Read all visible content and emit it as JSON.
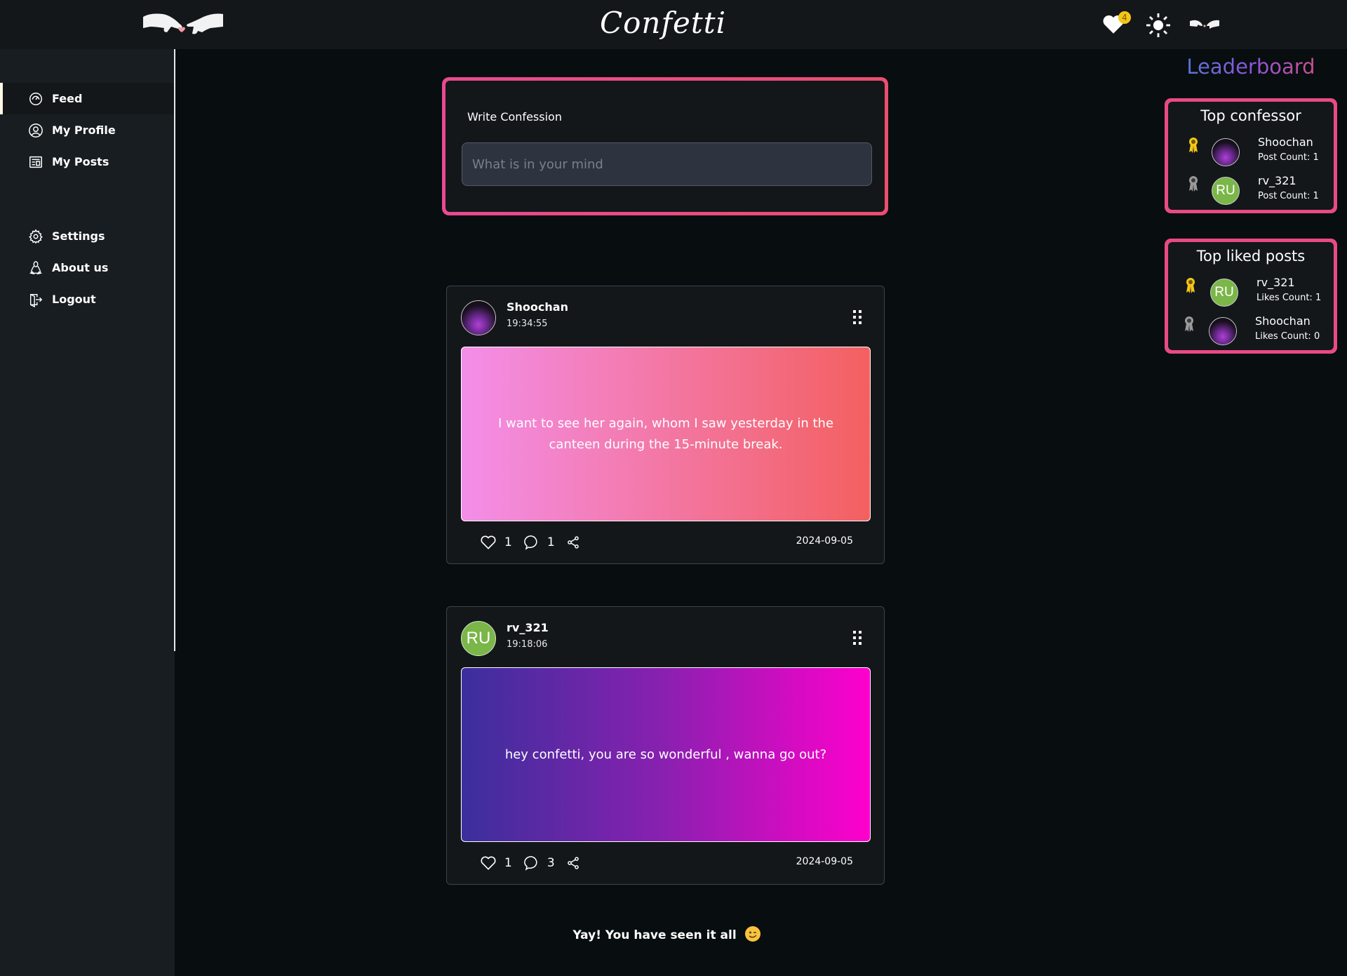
{
  "header": {
    "brand": "Confetti",
    "notification_count": "4",
    "icons": [
      "hands-logo-icon",
      "heart-icon",
      "sun-icon",
      "hands-icon"
    ]
  },
  "sidebar": {
    "items": [
      {
        "label": "Feed",
        "icon": "speedometer-icon",
        "active": true
      },
      {
        "label": "My Profile",
        "icon": "user-circle-icon",
        "active": false
      },
      {
        "label": "My Posts",
        "icon": "newspaper-icon",
        "active": false
      },
      {
        "label": "Settings",
        "icon": "gear-icon",
        "active": false
      },
      {
        "label": "About us",
        "icon": "linux-icon",
        "active": false
      },
      {
        "label": "Logout",
        "icon": "logout-icon",
        "active": false
      }
    ]
  },
  "composer": {
    "label": "Write Confession",
    "placeholder": "What is in your mind",
    "value": ""
  },
  "posts": [
    {
      "username": "Shoochan",
      "time": "19:34:55",
      "avatar": "image",
      "text": "I want to see her again, whom I saw yesterday in the canteen during the 15-minute break.",
      "likes": "1",
      "comments": "1",
      "date": "2024-09-05",
      "gradient": [
        "#f38ee8",
        "#f36060"
      ]
    },
    {
      "username": "rv_321",
      "time": "19:18:06",
      "avatar": "RU",
      "text": "hey confetti, you are so wonderful , wanna go out?",
      "likes": "1",
      "comments": "3",
      "date": "2024-09-05",
      "gradient": [
        "#3b2f9c",
        "#ff00cc"
      ]
    }
  ],
  "footer": {
    "message": "Yay! You have seen it all"
  },
  "leaderboard": {
    "title": "Leaderboard",
    "top_confessor": {
      "heading": "Top confessor",
      "entries": [
        {
          "rank": "gold",
          "name": "Shoochan",
          "avatar": "image",
          "count_label": "Post Count: 1"
        },
        {
          "rank": "silver",
          "name": "rv_321",
          "avatar": "RU",
          "count_label": "Post Count: 1"
        }
      ]
    },
    "top_liked": {
      "heading": "Top liked posts",
      "entries": [
        {
          "rank": "gold",
          "name": "rv_321",
          "avatar": "RU",
          "count_label": "Likes Count: 1"
        },
        {
          "rank": "silver",
          "name": "Shoochan",
          "avatar": "image",
          "count_label": "Likes Count: 0"
        }
      ]
    }
  },
  "colors": {
    "accent_border": "#e84a84",
    "ribbon_gold": "#f5c518",
    "ribbon_silver": "#9a9a9a",
    "avatar_green": "#7ab648"
  }
}
